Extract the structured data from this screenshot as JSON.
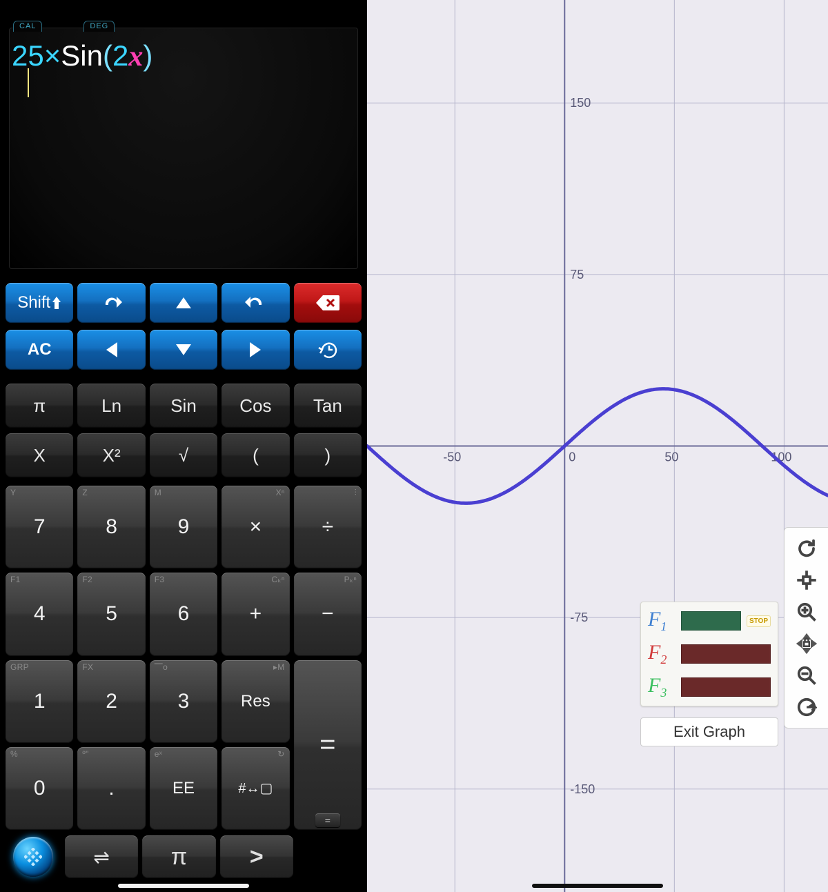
{
  "modes": {
    "cal": "CAL",
    "deg": "DEG"
  },
  "expression": {
    "coef": "25",
    "times": "×",
    "fn": "Sin",
    "open": "(",
    "arg_num": "2",
    "arg_var": "x",
    "close": ")"
  },
  "blue_row1": {
    "shift": "Shift"
  },
  "blue_row2": {
    "ac": "AC"
  },
  "fn_row1": [
    "π",
    "Ln",
    "Sin",
    "Cos",
    "Tan"
  ],
  "fn_row2": [
    "X",
    "X²",
    "√",
    "(",
    ")"
  ],
  "numpad": {
    "r1": [
      {
        "main": "7",
        "alt": "Y"
      },
      {
        "main": "8",
        "alt": "Z"
      },
      {
        "main": "9",
        "alt": "M"
      },
      {
        "main": "×",
        "alt": "Xⁿ"
      },
      {
        "main": "÷",
        "alt": "⫶"
      }
    ],
    "r2": [
      {
        "main": "4",
        "alt": "F1"
      },
      {
        "main": "5",
        "alt": "F2"
      },
      {
        "main": "6",
        "alt": "F3"
      },
      {
        "main": "+",
        "alt": "Cₖⁿ"
      },
      {
        "main": "−",
        "alt": "Pₖⁿ"
      }
    ],
    "r3": [
      {
        "main": "1",
        "alt": "GRP"
      },
      {
        "main": "2",
        "alt": "FX"
      },
      {
        "main": "3",
        "alt": "⎺o"
      },
      {
        "main": "Res",
        "alt": "▸M"
      }
    ],
    "r4": [
      {
        "main": "0",
        "alt": "%"
      },
      {
        "main": ".",
        "alt": "º\""
      },
      {
        "main": "EE",
        "alt": "eˣ"
      },
      {
        "main": "#↔▢",
        "alt": "↻"
      }
    ],
    "eq": "=",
    "eq_mini": "="
  },
  "bottombar": {
    "swap": "⇌",
    "pi": "π",
    "gt": ">"
  },
  "chart_data": {
    "type": "line",
    "title": "",
    "xlabel": "",
    "ylabel": "",
    "x_ticks": [
      -50,
      0,
      50,
      100
    ],
    "y_ticks": [
      -150,
      -75,
      75,
      150
    ],
    "xlim": [
      -90,
      120
    ],
    "ylim": [
      -195,
      195
    ],
    "series": [
      {
        "name": "F1",
        "color": "#4a3fd1",
        "expression": "25×Sin(2x)",
        "mode": "DEG"
      }
    ],
    "x": [
      -90,
      -80,
      -70,
      -60,
      -50,
      -40,
      -30,
      -20,
      -10,
      0,
      10,
      20,
      30,
      40,
      50,
      60,
      70,
      80,
      90,
      100,
      110,
      120
    ],
    "values": [
      0,
      -8.55,
      -16.07,
      -21.65,
      -24.62,
      -24.62,
      -21.65,
      -16.07,
      -8.55,
      0,
      8.55,
      16.07,
      21.65,
      24.62,
      24.62,
      21.65,
      16.07,
      8.55,
      0,
      -8.55,
      -16.07,
      -21.65
    ]
  },
  "legend": {
    "items": [
      {
        "label": "F₁",
        "color": "#2e6b4c",
        "active": true
      },
      {
        "label": "F₂",
        "color": "#6a2929",
        "active": false
      },
      {
        "label": "F₃",
        "color": "#6a2929",
        "active": false
      }
    ],
    "stop": "STOP"
  },
  "legend_labels": {
    "f1": "F",
    "f1s": "1",
    "f2": "F",
    "f2s": "2",
    "f3": "F",
    "f3s": "3"
  },
  "legend_colors": {
    "f1": "#3e7fd1",
    "f2": "#d13b3b",
    "f3": "#3bbf5f"
  },
  "exit_graph": "Exit Graph"
}
